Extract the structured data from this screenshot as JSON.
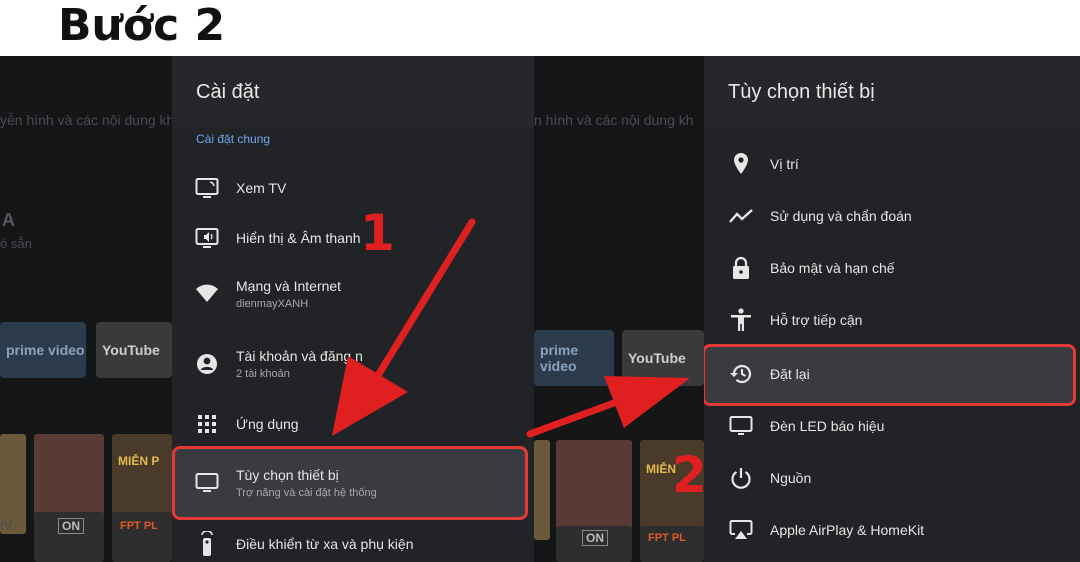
{
  "step_title": "Bước 2",
  "background": {
    "left_text_line": "yễn hình và các nội dung kh",
    "right_text_line": "n hình và các nội dung kh",
    "left_big_letter": "A",
    "left_small": "ó sẵn",
    "tiles": [
      "prime video",
      "YouTube",
      "prime video",
      "YouTube"
    ],
    "thumb_labels": [
      "MIỄN P",
      "ON",
      "FPT PL",
      "ON",
      "FPT PL",
      "MIỄN"
    ],
    "left_edge_small": "tV"
  },
  "settings": {
    "title": "Cài đặt",
    "section": "Cài đặt chung",
    "items": [
      {
        "label": "Xem TV",
        "sub": "",
        "icon": "tv-input-icon"
      },
      {
        "label": "Hiển thị & Âm thanh",
        "sub": "",
        "icon": "display-sound-icon"
      },
      {
        "label": "Mạng và Internet",
        "sub": "dienmayXANH",
        "icon": "wifi-icon"
      },
      {
        "label": "Tài khoản và đăng n",
        "sub": "2 tài khoản",
        "icon": "account-icon"
      },
      {
        "label": "Ứng dụng",
        "sub": "",
        "icon": "apps-grid-icon"
      },
      {
        "label": "Tùy chọn thiết bị",
        "sub": "Trợ năng và cài đặt hệ thống",
        "icon": "device-icon"
      },
      {
        "label": "Điều khiển từ xa và phụ kiện",
        "sub": "",
        "icon": "remote-icon"
      }
    ]
  },
  "device": {
    "title": "Tùy chọn thiết bị",
    "items": [
      {
        "label": "Vị trí",
        "icon": "location-pin-icon"
      },
      {
        "label": "Sử dụng và chẩn đoán",
        "icon": "trend-line-icon"
      },
      {
        "label": "Bảo mật và hạn chế",
        "icon": "lock-icon"
      },
      {
        "label": "Hỗ trợ tiếp cận",
        "icon": "accessibility-icon"
      },
      {
        "label": "Đặt lại",
        "icon": "reset-history-icon"
      },
      {
        "label": "Đèn LED báo hiệu",
        "icon": "monitor-icon"
      },
      {
        "label": "Nguồn",
        "icon": "power-icon"
      },
      {
        "label": "Apple AirPlay & HomeKit",
        "icon": "airplay-icon"
      }
    ]
  },
  "annotations": {
    "step_one": "1",
    "step_two": "2",
    "color": "#e02020"
  }
}
